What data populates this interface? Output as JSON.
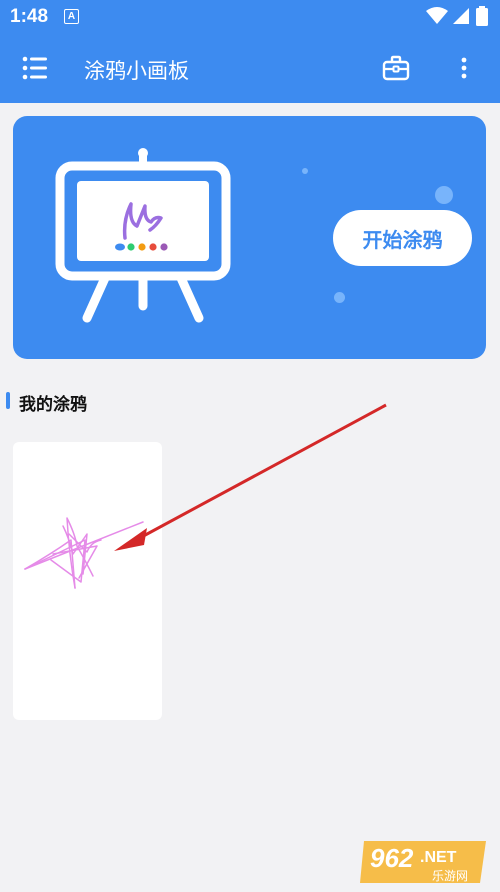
{
  "status_bar": {
    "time": "1:48",
    "notification_letter": "A",
    "icons": [
      "wifi-icon",
      "cell-signal-icon",
      "battery-icon"
    ]
  },
  "app_bar": {
    "title": "涂鸦小画板",
    "menu_icon": "hamburger-menu-icon",
    "toolbox_icon": "briefcase-icon",
    "more_icon": "more-vertical-icon"
  },
  "banner": {
    "start_label": "开始涂鸦",
    "illustration": "easel-icon",
    "palette_colors": [
      "#3d8bf0",
      "#2ecc71",
      "#f39c12",
      "#e74c3c",
      "#9b59b6"
    ]
  },
  "section": {
    "title": "我的涂鸦"
  },
  "drawings": [
    {
      "thumbnail": "pink-star-scribble",
      "stroke_color": "#e58be8"
    }
  ],
  "annotation": {
    "arrow_color": "#d42828"
  },
  "watermark": {
    "brand": "962",
    "suffix": ".NET",
    "subtitle": "乐游网"
  },
  "colors": {
    "primary": "#3d8bf0",
    "background": "#f2f2f4",
    "card": "#ffffff"
  }
}
